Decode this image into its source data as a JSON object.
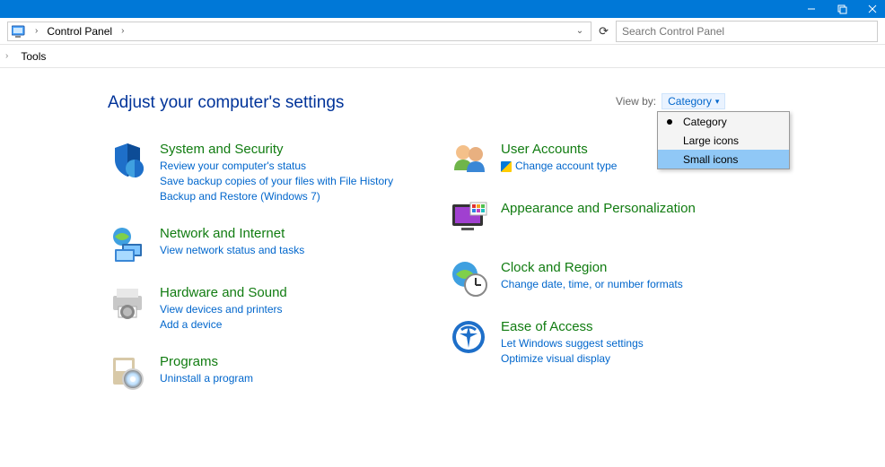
{
  "window": {
    "title": "Control Panel"
  },
  "addressbar": {
    "location": "Control Panel"
  },
  "search": {
    "placeholder": "Search Control Panel"
  },
  "menu": {
    "tools": "Tools"
  },
  "headline": "Adjust your computer's settings",
  "viewby": {
    "label": "View by:",
    "current": "Category",
    "options": [
      "Category",
      "Large icons",
      "Small icons"
    ],
    "selected": "Category",
    "hovered": "Small icons"
  },
  "left": [
    {
      "title": "System and Security",
      "links": [
        "Review your computer's status",
        "Save backup copies of your files with File History",
        "Backup and Restore (Windows 7)"
      ]
    },
    {
      "title": "Network and Internet",
      "links": [
        "View network status and tasks"
      ]
    },
    {
      "title": "Hardware and Sound",
      "links": [
        "View devices and printers",
        "Add a device"
      ]
    },
    {
      "title": "Programs",
      "links": [
        "Uninstall a program"
      ]
    }
  ],
  "right": [
    {
      "title": "User Accounts",
      "links": [
        {
          "text": "Change account type",
          "shield": true
        }
      ]
    },
    {
      "title": "Appearance and Personalization",
      "links": []
    },
    {
      "title": "Clock and Region",
      "links": [
        "Change date, time, or number formats"
      ]
    },
    {
      "title": "Ease of Access",
      "links": [
        "Let Windows suggest settings",
        "Optimize visual display"
      ]
    }
  ]
}
